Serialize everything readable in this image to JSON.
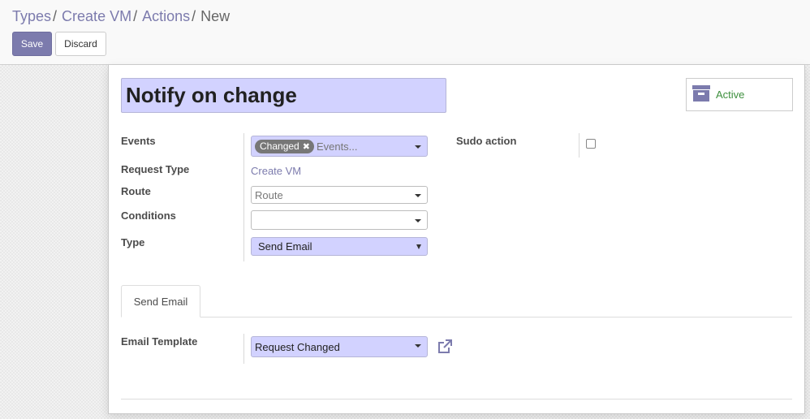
{
  "breadcrumb": {
    "items": [
      "Types",
      "Create VM",
      "Actions"
    ],
    "separator": "/",
    "current": "New"
  },
  "toolbar": {
    "save_label": "Save",
    "discard_label": "Discard"
  },
  "form": {
    "name": "Notify on change",
    "active_label": "Active",
    "fields": {
      "events": {
        "label": "Events",
        "tags": [
          "Changed"
        ],
        "placeholder": "Events..."
      },
      "request_type": {
        "label": "Request Type",
        "value": "Create VM"
      },
      "route": {
        "label": "Route",
        "placeholder": "Route"
      },
      "conditions": {
        "label": "Conditions",
        "value": ""
      },
      "type": {
        "label": "Type",
        "value": "Send Email"
      },
      "sudo_action": {
        "label": "Sudo action",
        "checked": false
      }
    },
    "tabs": [
      {
        "label": "Send Email",
        "active": true
      }
    ],
    "email_template": {
      "label": "Email Template",
      "value": "Request Changed"
    }
  },
  "colors": {
    "accent": "#7c7bad",
    "required_bg": "#d2d2ff",
    "active_green": "#3d8f3d"
  },
  "icons": {
    "archive": "archive-box-icon",
    "external_link": "external-link-icon"
  }
}
